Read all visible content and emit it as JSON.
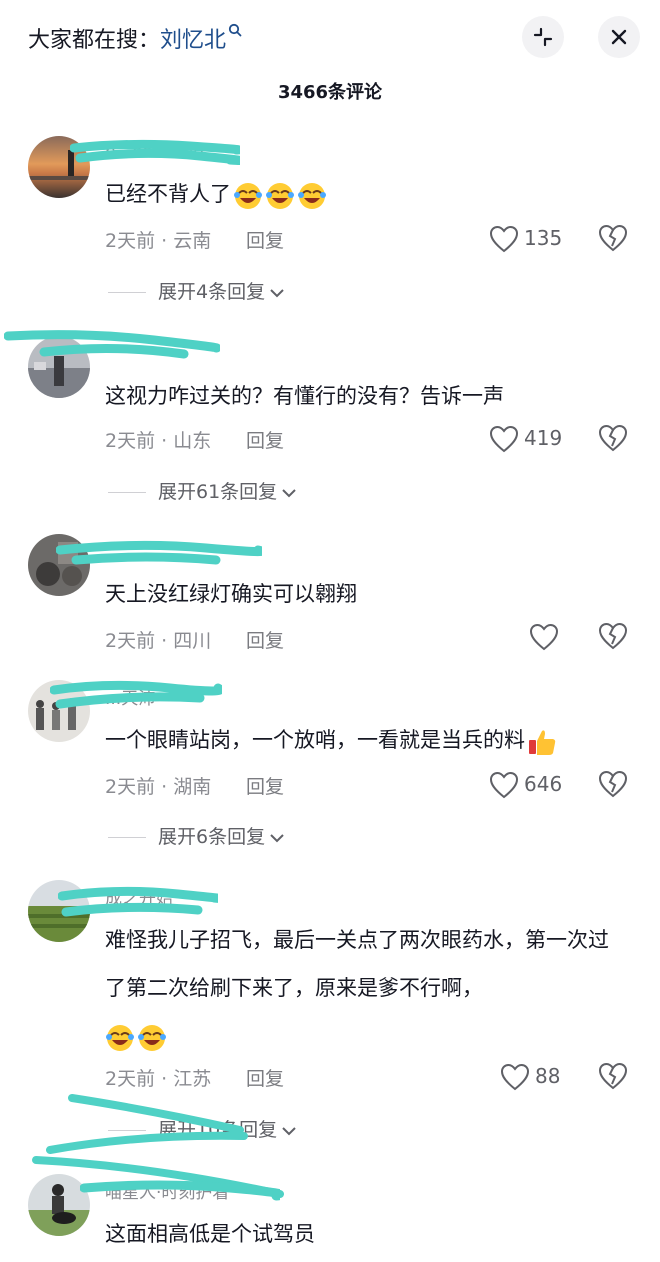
{
  "header": {
    "search_prefix": "大家都在搜：",
    "search_keyword": "刘忆北",
    "comment_count": "3466条评论"
  },
  "comments": [
    {
      "username": "b...ea.wend",
      "text": "已经不背人了",
      "emoji": [
        "laugh-cry",
        "laugh-cry",
        "laugh-cry"
      ],
      "time_location": "2天前 · 云南",
      "reply": "回复",
      "likes": "135",
      "expand": "展开4条回复"
    },
    {
      "username": "",
      "text": "这视力咋过关的？有懂行的没有？告诉一声",
      "time_location": "2天前 · 山东",
      "reply": "回复",
      "likes": "419",
      "expand": "展开61条回复"
    },
    {
      "username": "",
      "text": "天上没红绿灯确实可以翱翔",
      "time_location": "2天前 · 四川",
      "reply": "回复",
      "likes": ""
    },
    {
      "username": "...天沛",
      "text": "一个眼睛站岗，一个放哨，一看就是当兵的料",
      "emoji": [
        "thumbs-up"
      ],
      "time_location": "2天前 · 湖南",
      "reply": "回复",
      "likes": "646",
      "expand": "展开6条回复"
    },
    {
      "username": "成之开始",
      "text": "难怪我儿子招飞，最后一关点了两次眼药水，第一次过了第二次给刷下来了，原来是爹不行啊，",
      "emoji": [
        "laugh-cry",
        "laugh-cry"
      ],
      "time_location": "2天前 · 江苏",
      "reply": "回复",
      "likes": "88",
      "expand": "展开10条回复"
    },
    {
      "username": "喵星人·时刻护着",
      "text": "这面相高低是个试驾员"
    }
  ],
  "colors": {
    "accent_keyword": "#1f4e8c",
    "scribble": "#4fd1c5",
    "text": "#161823",
    "muted": "#8a8b91"
  }
}
